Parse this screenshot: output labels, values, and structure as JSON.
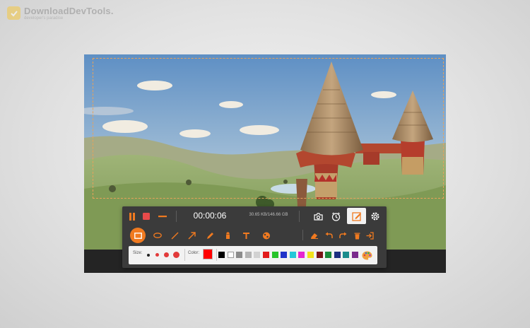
{
  "watermark": {
    "title": "DownloadDevTools.",
    "subtitle": "developer's paradise"
  },
  "recorder": {
    "timer": "00:00:06",
    "file_size": "30.65 KB/146.66 GB",
    "size_label": "Size:",
    "color_label": "Color:",
    "accent_color": "#f07a20",
    "current_color": "#ff0000",
    "palette": [
      "#000000",
      "#ffffff",
      "#8c8c8c",
      "#b4b4b4",
      "#d2d2d2",
      "#e21b1b",
      "#27c42a",
      "#2033c9",
      "#24c8d8",
      "#e626d0",
      "#f2e21c",
      "#7a1416",
      "#1b8a3a",
      "#1b2f80",
      "#1a8c8c",
      "#7a2a8c"
    ],
    "icons_row1": [
      "pause-icon",
      "stop-icon",
      "minimize-icon",
      "camera-icon",
      "clock-icon",
      "edit-icon",
      "gear-icon"
    ],
    "icons_row2": [
      "rectangle-icon",
      "ellipse-icon",
      "line-icon",
      "arrow-icon",
      "pencil-icon",
      "highlighter-icon",
      "text-icon",
      "blur-icon",
      "eraser-icon",
      "undo-icon",
      "redo-icon",
      "delete-icon",
      "exit-icon"
    ]
  }
}
